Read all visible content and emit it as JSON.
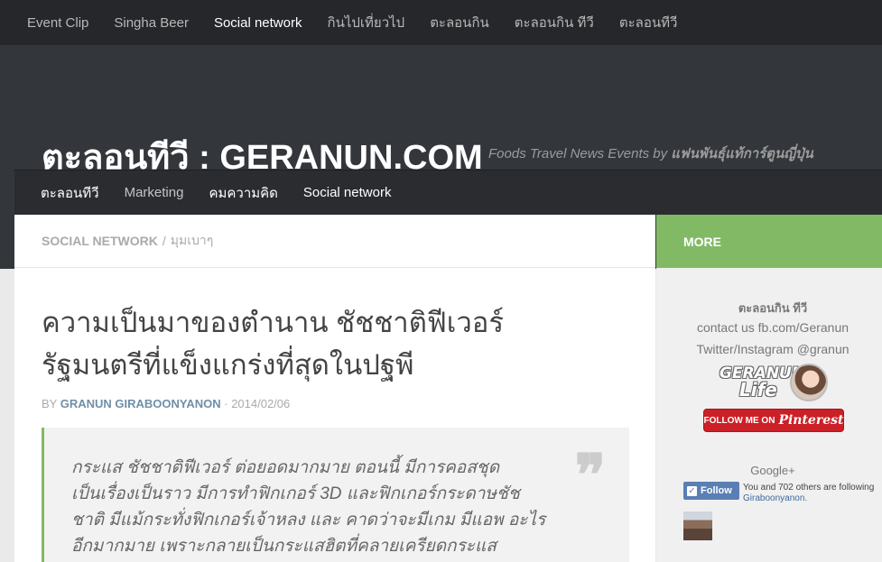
{
  "top_nav": {
    "items": [
      {
        "label": "Event Clip",
        "active": false
      },
      {
        "label": "Singha Beer",
        "active": false
      },
      {
        "label": "Social network",
        "active": true
      },
      {
        "label": "กินไปเที่ยวไป",
        "active": false
      },
      {
        "label": "ตะลอนกิน",
        "active": false
      },
      {
        "label": "ตะลอนกิน ทีวี",
        "active": false
      },
      {
        "label": "ตะลอนทีวี",
        "active": false
      }
    ]
  },
  "header": {
    "site_title": "ตะลอนทีวี : GERANUN.COM",
    "tagline_prefix": "Foods Travel News Events by ",
    "tagline_author": "แฟนพันธุ์แท้การ์ตูนญี่ปุ่น"
  },
  "sub_nav": {
    "items": [
      {
        "label": "ตะลอนทีวี"
      },
      {
        "label": "Marketing"
      },
      {
        "label": "คมความคิด"
      },
      {
        "label": "Social network"
      }
    ]
  },
  "breadcrumb": {
    "category": "Social network",
    "separator": "/",
    "subcategory": "มุมเบาๆ"
  },
  "post": {
    "title_line1": "ความเป็นมาของตำนาน ชัชชาติฟีเวอร์",
    "title_line2": "รัฐมนตรีที่แข็งแกร่งที่สุดในปฐพี",
    "byline_prefix": "BY ",
    "author": "Granun Giraboonyanon",
    "date_sep": " · ",
    "date": "2014/02/06",
    "quote_mark": "❞",
    "quote_lines": [
      "กระแส ชัชชาติฟีเวอร์ ต่อยอดมากมาย ตอนนี้ มีการคอสชุด",
      "เป็นเรื่องเป็นราว มีการทำฟิกเกอร์ 3D และฟิกเกอร์กระดาษชัช",
      "ชาติ มีแม้กระทั่งฟิกเกอร์เจ้าหลง และ คาดว่าจะมีเกม มีแอพ อะไร",
      "อีกมากมาย เพราะกลายเป็นกระแสฮิตที่คลายเครียดกระแส"
    ]
  },
  "sidebar": {
    "more_label": "MORE",
    "widget_title": "ตะลอนกิน ทีวี",
    "contact_line": "contact us fb.com/Geranun",
    "social_line": "Twitter/Instagram @granun",
    "logo_line1": "GERANUN",
    "logo_line2": "Life",
    "pinterest_prefix": "FOLLOW ME ON",
    "pinterest_word": "Pinterest",
    "gplus_title": "Google+",
    "follow_label": "Follow",
    "follow_count_line": "You and 702 others are following",
    "follow_name": "Giraboonyanon."
  },
  "colors": {
    "top_nav_bg": "#26272b",
    "header_bg": "#33363b",
    "accent_green": "#82b965",
    "link_blue": "#6f8fa8",
    "pinterest_red": "#cb2027"
  }
}
